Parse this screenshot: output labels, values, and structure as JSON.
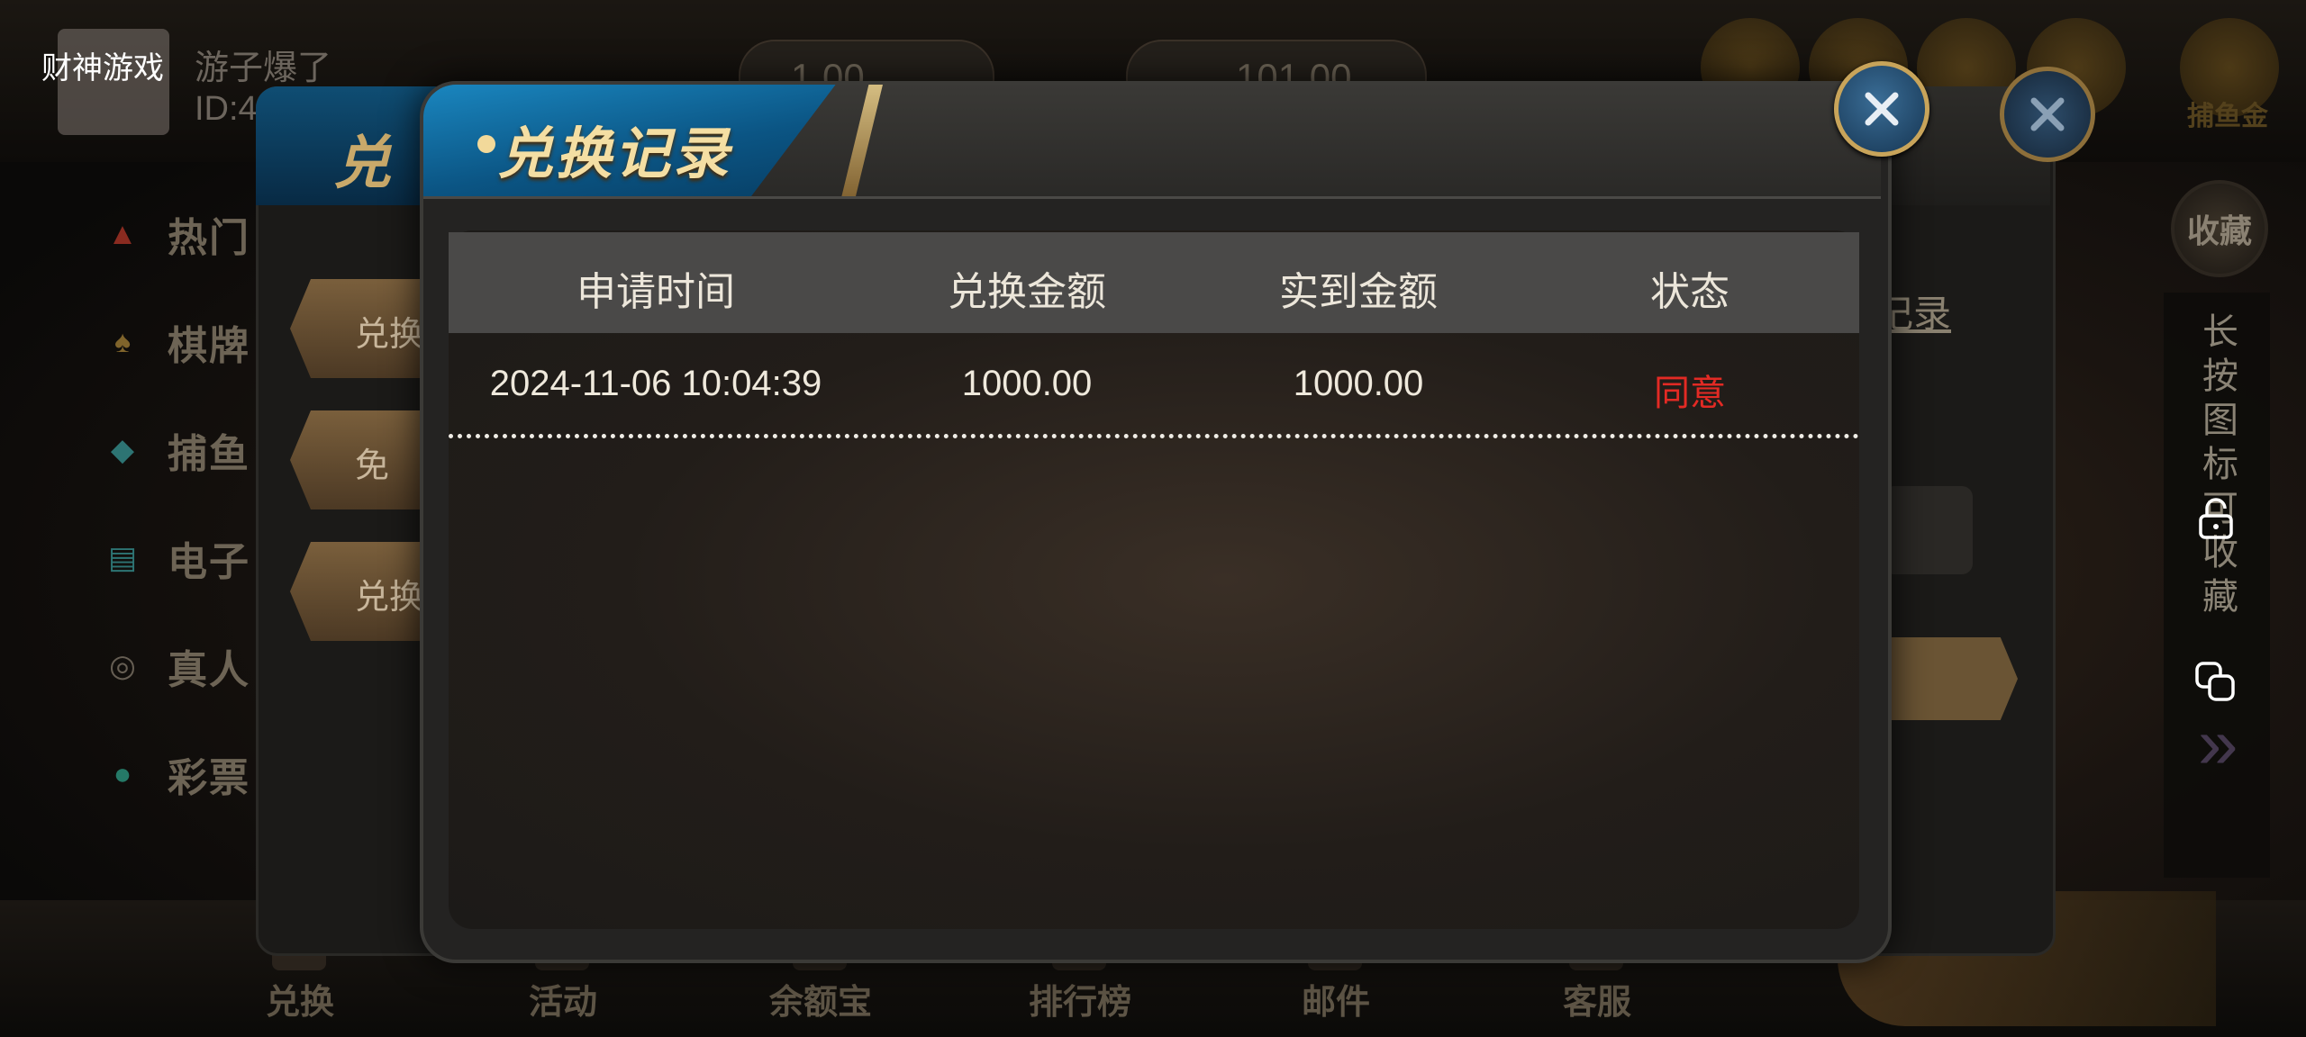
{
  "app": {
    "title": "财神游戏"
  },
  "user": {
    "name": "游子爆了",
    "id_label": "ID:4"
  },
  "header": {
    "balance_1": "1.00",
    "balance_2": "101.00"
  },
  "left_menu": [
    {
      "label": "热门",
      "icon": "hot-icon"
    },
    {
      "label": "棋牌",
      "icon": "spade-icon"
    },
    {
      "label": "捕鱼",
      "icon": "shark-icon"
    },
    {
      "label": "电子",
      "icon": "slot-machine-icon"
    },
    {
      "label": "真人",
      "icon": "roulette-icon"
    },
    {
      "label": "彩票",
      "icon": "lottery-icon"
    }
  ],
  "bottom_nav": [
    {
      "label": "兑换"
    },
    {
      "label": "活动"
    },
    {
      "label": "余额宝"
    },
    {
      "label": "排行榜"
    },
    {
      "label": "邮件"
    },
    {
      "label": "客服"
    }
  ],
  "right_badges": [
    {
      "label": "捕鱼金"
    }
  ],
  "side_strip": {
    "favorite_label": "收藏",
    "hint_text": "长按图标可收藏"
  },
  "back_modal": {
    "title": "兑",
    "side_buttons": [
      "兑换",
      "免",
      "兑换"
    ],
    "link_text": "记录"
  },
  "modal": {
    "title": "兑换记录",
    "columns": [
      "申请时间",
      "兑换金额",
      "实到金额",
      "状态"
    ],
    "rows": [
      {
        "time": "2024-11-06 10:04:39",
        "amount": "1000.00",
        "received": "1000.00",
        "status": "同意",
        "status_color": "#e32a24"
      }
    ]
  }
}
